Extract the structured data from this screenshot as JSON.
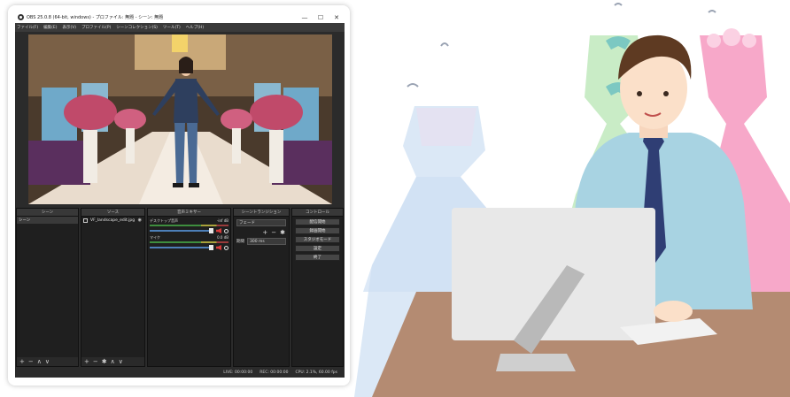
{
  "window": {
    "title": "OBS 25.0.8 (64-bit, windows) - プロファイル: 無題 - シーン: 無題",
    "minimize_glyph": "—",
    "maximize_glyph": "☐",
    "close_glyph": "✕"
  },
  "menu": {
    "items": [
      "ファイル(F)",
      "編集(E)",
      "表示(V)",
      "プロファイル(P)",
      "シーンコレクション(S)",
      "ツール(T)",
      "ヘルプ(H)"
    ]
  },
  "scenes": {
    "title": "シーン",
    "items": [
      "シーン"
    ]
  },
  "sources": {
    "title": "ソース",
    "items": [
      {
        "label": "VF_landscape_edit.jpg"
      }
    ]
  },
  "mixer": {
    "title": "音声ミキサー",
    "tracks": [
      {
        "name": "デスクトップ音声",
        "level": "-inf dB",
        "volume": 0.95
      },
      {
        "name": "マイク",
        "level": "0.0 dB",
        "volume": 0.95
      }
    ]
  },
  "transitions": {
    "title": "シーントランジション",
    "selected": "フェード",
    "duration_label": "期間",
    "duration_value": "300 ms"
  },
  "controls": {
    "title": "コントロール",
    "buttons": [
      "配信開始",
      "録画開始",
      "スタジオモード",
      "設定",
      "終了"
    ]
  },
  "dock_footer": {
    "add": "+",
    "remove": "−",
    "up": "∧",
    "down": "∨",
    "settings": "✱"
  },
  "status": {
    "live": "LIVE: 00:00:00",
    "rec": "REC: 00:00:00",
    "cpu": "CPU: 2.1%, 60.00 fps"
  },
  "colors": {
    "obs_background": "#2b2b2b",
    "dock_background": "#1f1f1f",
    "mute_red": "#d93a3a",
    "volume_blue": "#4d7fb8"
  }
}
